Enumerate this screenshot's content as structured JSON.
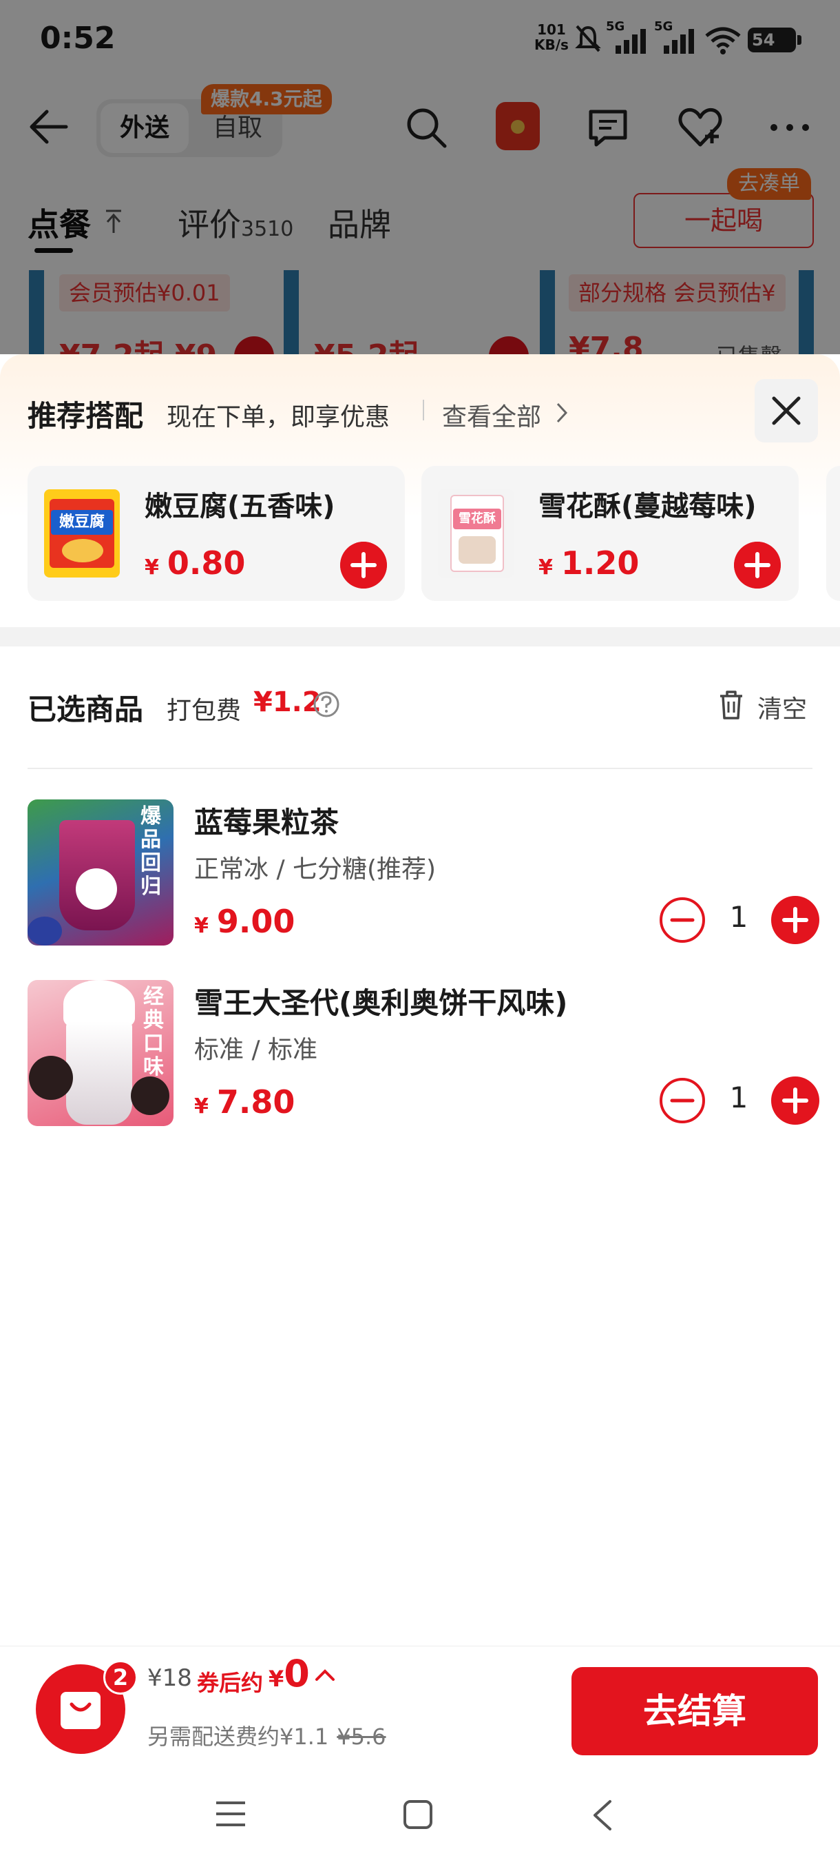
{
  "status_bar": {
    "time": "0:52",
    "net_speed_value": "101",
    "net_speed_unit": "KB/s",
    "signal_1": "5G",
    "signal_2": "5G",
    "battery": "54"
  },
  "nav": {
    "mode_active": "外送",
    "mode_inactive": "自取",
    "hot_badge": "爆款4.3元起"
  },
  "tabs": {
    "order": "点餐",
    "reviews": "评价",
    "reviews_count": "3510",
    "brand": "品牌",
    "together_button": "一起喝",
    "together_badge": "去凑单"
  },
  "peek": {
    "tag_1": "会员预估¥0.01",
    "tag_2": "部分规格  会员预估¥",
    "price_1": "¥7.2起  ¥9",
    "price_2": "¥5.2起",
    "price_3": "¥7.8",
    "sold": "已售罄"
  },
  "recommend": {
    "title": "推荐搭配",
    "subtitle": "现在下单，即享优惠",
    "view_all": "查看全部",
    "items": [
      {
        "name": "嫩豆腐(五香味)",
        "currency": "¥",
        "price": "0.80",
        "thumb_text": "嫩豆腐"
      },
      {
        "name": "雪花酥(蔓越莓味)",
        "currency": "¥",
        "price": "1.20",
        "thumb_text": "雪花酥"
      }
    ]
  },
  "selected": {
    "title": "已选商品",
    "packing_fee_label": "打包费",
    "packing_fee": "¥1.2",
    "clear_label": "清空",
    "items": [
      {
        "name": "蓝莓果粒茶",
        "spec": "正常冰 / 七分糖(推荐)",
        "currency": "¥",
        "price": "9.00",
        "qty": "1",
        "img_text": "爆品回归"
      },
      {
        "name": "雪王大圣代(奥利奥饼干风味)",
        "spec": "标准 / 标准",
        "currency": "¥",
        "price": "7.80",
        "qty": "1",
        "img_text": "经典口味"
      }
    ]
  },
  "cart": {
    "count": "2",
    "original_total": "¥18",
    "coupon_label": "券后约",
    "coupon_currency": "¥",
    "coupon_total": "0",
    "delivery_note": "另需配送费约¥1.1",
    "delivery_original": "¥5.6",
    "checkout_label": "去结算"
  },
  "colors": {
    "accent_red": "#e3141e",
    "badge_orange": "#ff6a1a"
  }
}
